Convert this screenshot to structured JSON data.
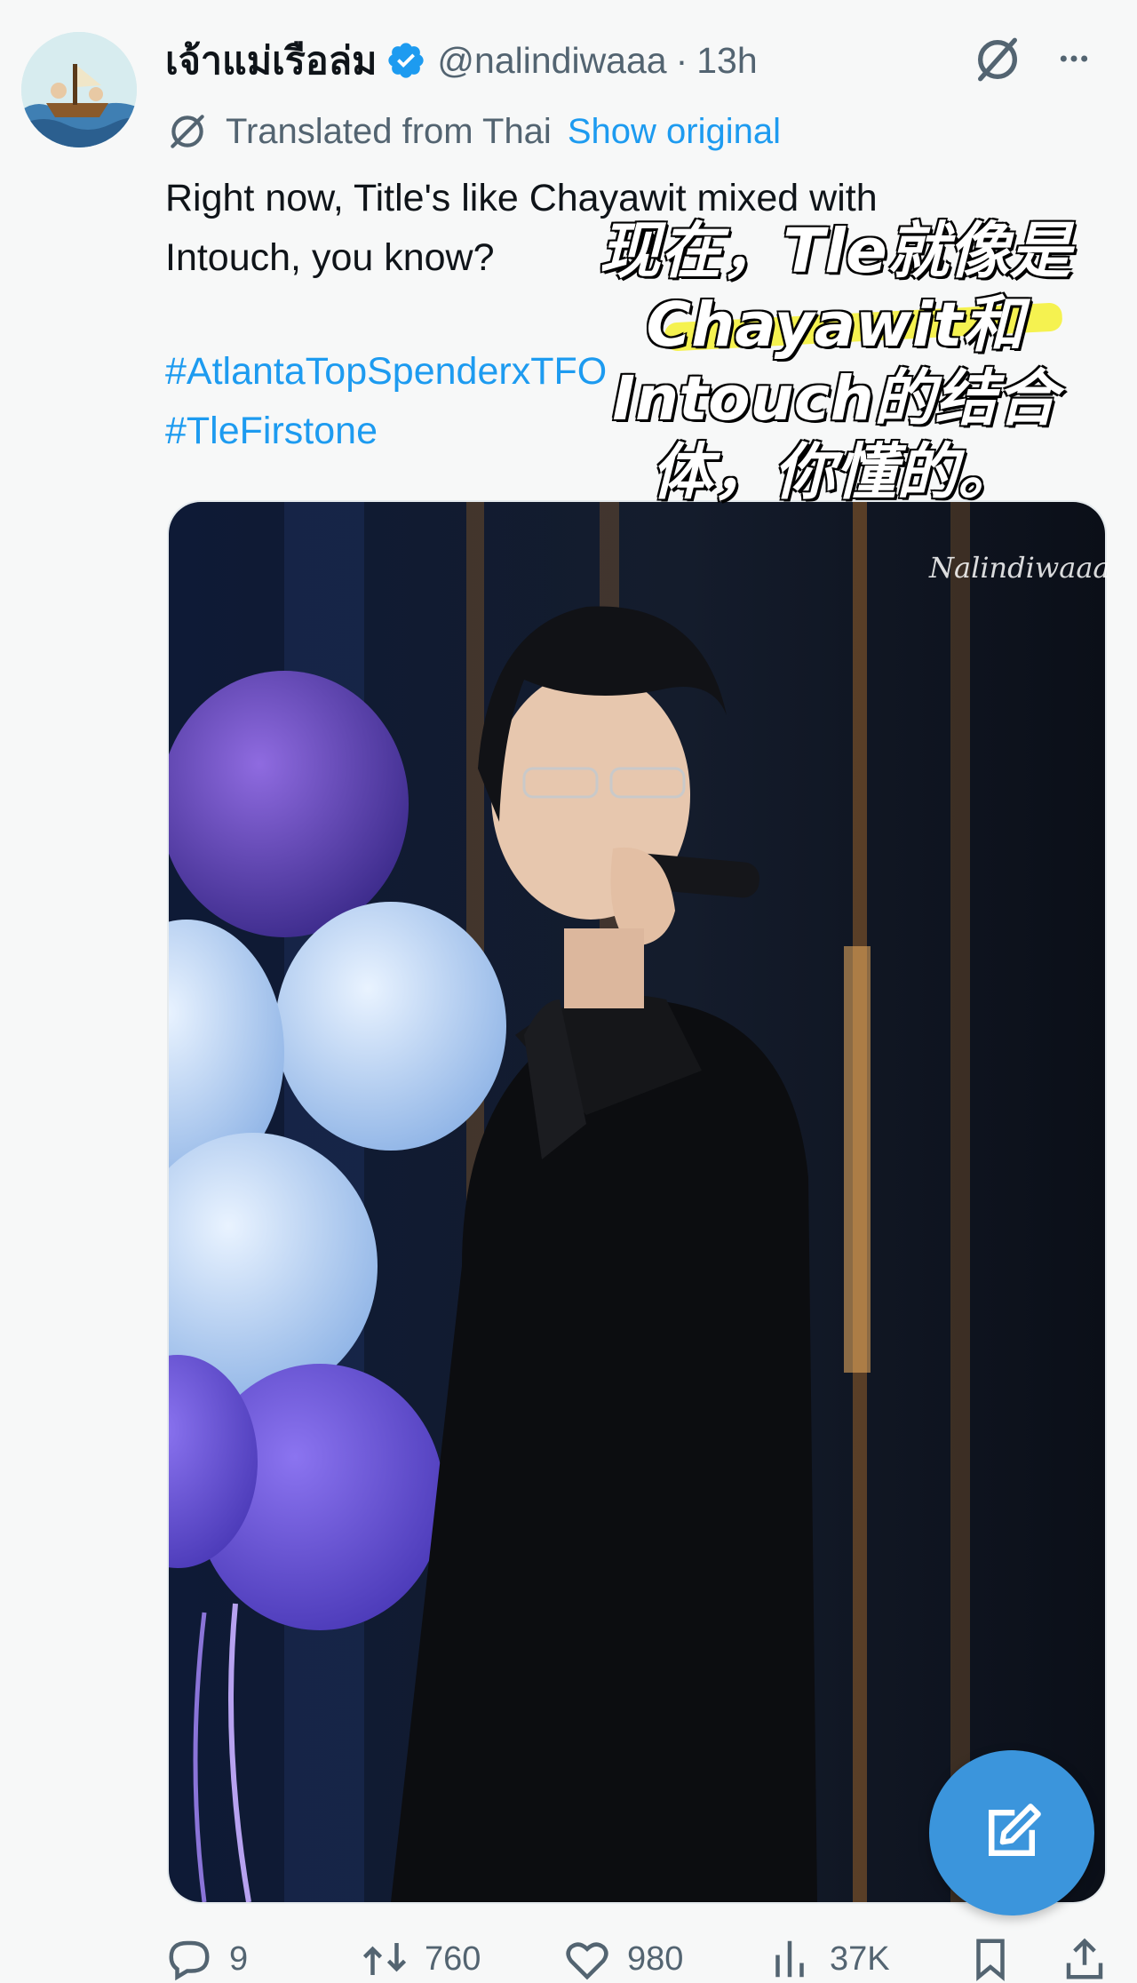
{
  "tweet": {
    "display_name": "เจ้าแม่เรือล่ม",
    "handle": "@nalindiwaaa",
    "separator": "·",
    "time": "13h",
    "translation_note": "Translated from Thai",
    "show_original": "Show original",
    "text": "Right now, Title's like Chayawit mixed with\nIntouch, you know?",
    "hashtags": [
      "#AtlantaTopSpenderxTFO",
      "#TleFirstone"
    ]
  },
  "overlay_caption": [
    "现在，Tle就像是",
    "Chayawit和",
    "Intouch的结合",
    "体，你懂的。"
  ],
  "photo": {
    "watermark": "Nalindiwaaa"
  },
  "actions": [
    {
      "icon": "reply-icon",
      "count": "9"
    },
    {
      "icon": "retweet-icon",
      "count": "760"
    },
    {
      "icon": "like-icon",
      "count": "980"
    },
    {
      "icon": "views-icon",
      "count": "37K"
    },
    {
      "icon": "bookmark-icon",
      "count": ""
    },
    {
      "icon": "share-icon",
      "count": ""
    }
  ],
  "colors": {
    "accent": "#1d9bf0",
    "muted": "#536471",
    "fab": "#3b95dc",
    "highlight": "#f5f250"
  }
}
